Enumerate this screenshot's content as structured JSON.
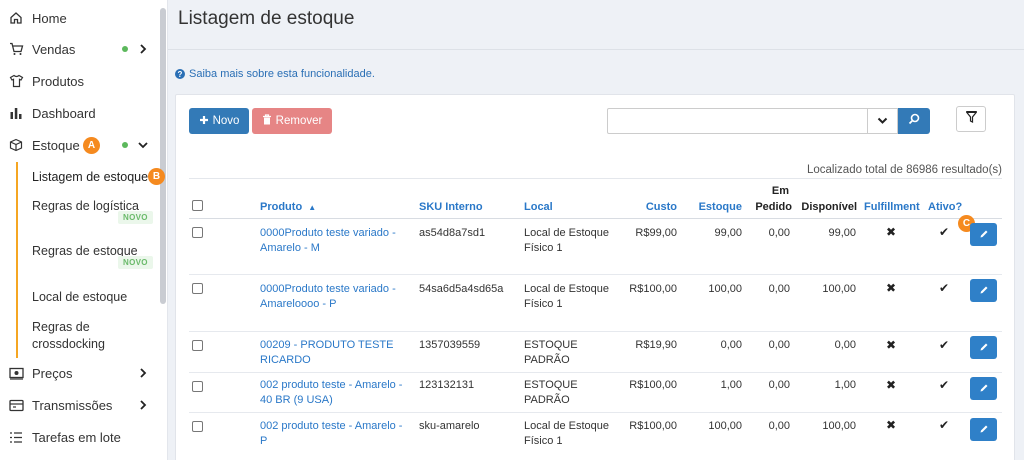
{
  "sidebar": {
    "items": [
      {
        "label": "Home",
        "icon": "home-icon"
      },
      {
        "label": "Vendas",
        "icon": "cart-icon"
      },
      {
        "label": "Produtos",
        "icon": "shirt-icon"
      },
      {
        "label": "Dashboard",
        "icon": "bar-chart-icon"
      },
      {
        "label": "Estoque",
        "icon": "box-icon"
      },
      {
        "label": "Preços",
        "icon": "price-icon"
      },
      {
        "label": "Transmissões",
        "icon": "transmission-icon"
      },
      {
        "label": "Tarefas em lote",
        "icon": "list-icon"
      }
    ],
    "sub_items": [
      {
        "label": "Listagem de estoque"
      },
      {
        "label": "Regras de logística",
        "badge": "NOVO"
      },
      {
        "label": "Regras de estoque",
        "badge": "NOVO"
      },
      {
        "label": "Local de estoque"
      },
      {
        "label": "Regras de crossdocking"
      }
    ],
    "status_dot_color": "#5cb85c",
    "active_accent": "#f5a623"
  },
  "markers": {
    "a": "A",
    "b": "B",
    "c": "C",
    "color": "#f58a1f"
  },
  "page": {
    "title": "Listagem de estoque",
    "help_link": "Saiba mais sobre esta funcionalidade."
  },
  "toolbar": {
    "novo_label": "Novo",
    "remover_label": "Remover",
    "search_placeholder": "",
    "result_count": "Localizado total de 86986 resultado(s)"
  },
  "table": {
    "headers": {
      "produto": "Produto",
      "sku": "SKU Interno",
      "local": "Local",
      "custo": "Custo",
      "estoque": "Estoque",
      "em_pedido": "Em Pedido",
      "em_pedido_line1": "Em",
      "em_pedido_line2": "Pedido",
      "disponivel": "Disponível",
      "fulfillment": "Fulfillment",
      "ativo": "Ativo?"
    },
    "rows": [
      {
        "produto": "0000Produto teste variado - Amarelo - M",
        "sku": "as54d8a7sd1",
        "local": "Local de Estoque Físico 1",
        "custo": "R$99,00",
        "estoque": "99,00",
        "em_pedido": "0,00",
        "disponivel": "99,00",
        "fulfillment": "✖",
        "ativo": "✔"
      },
      {
        "produto": "0000Produto teste variado - Amareloooo - P",
        "sku": "54sa6d5a4sd65a",
        "local": "Local de Estoque Físico 1",
        "custo": "R$100,00",
        "estoque": "100,00",
        "em_pedido": "0,00",
        "disponivel": "100,00",
        "fulfillment": "✖",
        "ativo": "✔"
      },
      {
        "produto": "00209 - PRODUTO TESTE RICARDO",
        "sku": "1357039559",
        "local": "ESTOQUE PADRÃO",
        "custo": "R$19,90",
        "estoque": "0,00",
        "em_pedido": "0,00",
        "disponivel": "0,00",
        "fulfillment": "✖",
        "ativo": "✔"
      },
      {
        "produto": "002 produto teste - Amarelo - 40 BR (9 USA)",
        "sku": "123132131",
        "local": "ESTOQUE PADRÃO",
        "custo": "R$100,00",
        "estoque": "1,00",
        "em_pedido": "0,00",
        "disponivel": "1,00",
        "fulfillment": "✖",
        "ativo": "✔"
      },
      {
        "produto": "002 produto teste - Amarelo - P",
        "sku": "sku-amarelo",
        "local": "Local de Estoque Físico 1",
        "custo": "R$100,00",
        "estoque": "100,00",
        "em_pedido": "0,00",
        "disponivel": "100,00",
        "fulfillment": "✖",
        "ativo": "✔"
      }
    ]
  },
  "colors": {
    "primary": "#337ab7",
    "danger_light": "#e68585",
    "link": "#2a78c8"
  }
}
